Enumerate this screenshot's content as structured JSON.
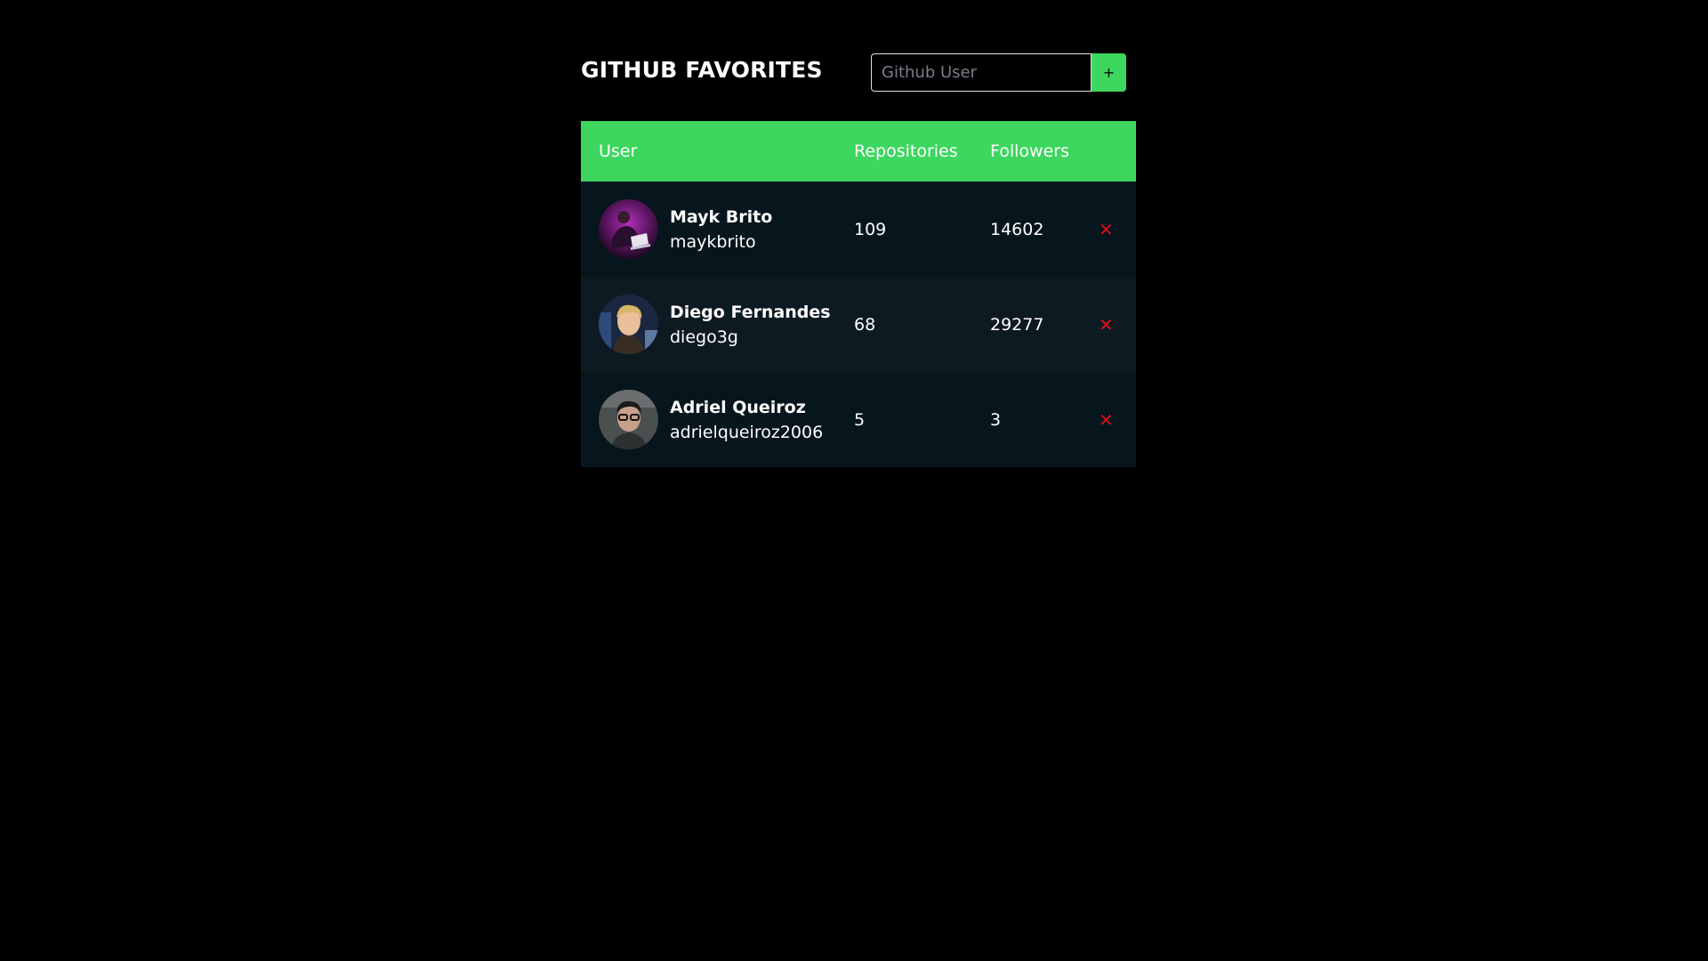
{
  "header": {
    "title": "GITHUB FAVORITES",
    "search_placeholder": "Github User",
    "add_label": "+"
  },
  "table": {
    "columns": [
      "User",
      "Repositories",
      "Followers"
    ],
    "rows": [
      {
        "name": "Mayk Brito",
        "login": "maykbrito",
        "repositories": "109",
        "followers": "14602",
        "remove_label": "✕"
      },
      {
        "name": "Diego Fernandes",
        "login": "diego3g",
        "repositories": "68",
        "followers": "29277",
        "remove_label": "✕"
      },
      {
        "name": "Adriel Queiroz",
        "login": "adrielqueiroz2006",
        "repositories": "5",
        "followers": "3",
        "remove_label": "✕"
      }
    ]
  },
  "colors": {
    "accent": "#3dd65e",
    "background": "#000000",
    "row_odd": "#06161c",
    "row_even": "#0e1a22",
    "remove": "#e10b1c"
  }
}
